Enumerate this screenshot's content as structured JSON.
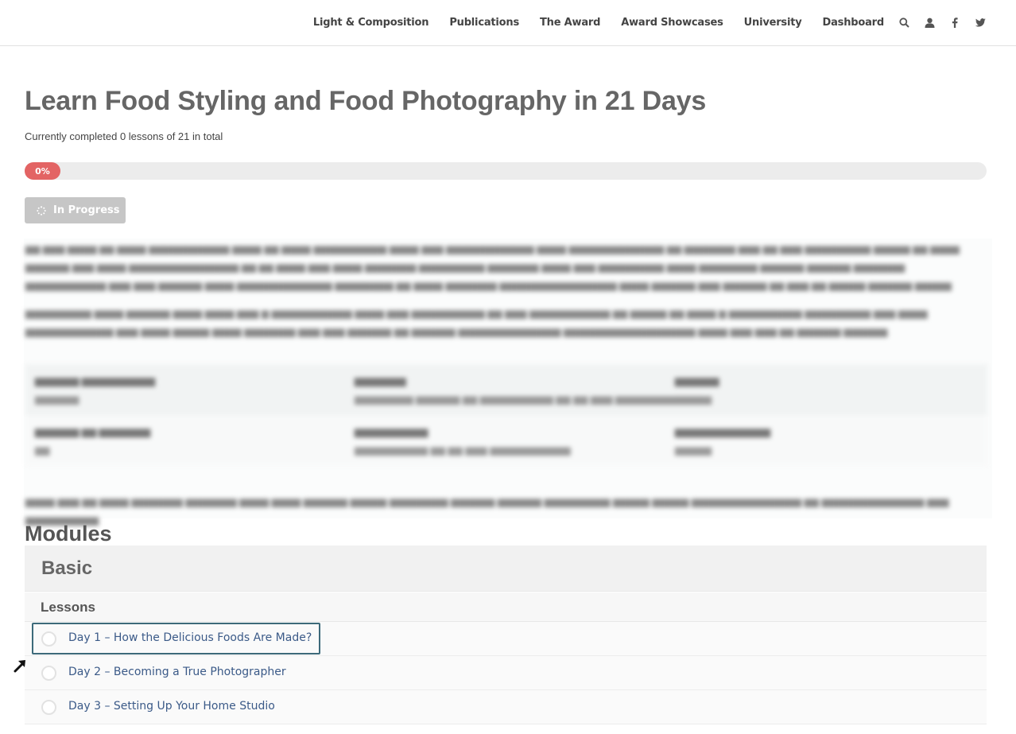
{
  "nav": {
    "links": [
      "Light & Composition",
      "Publications",
      "The Award",
      "Award Showcases",
      "University",
      "Dashboard"
    ],
    "icons": [
      "search-icon",
      "user-icon",
      "facebook-icon",
      "twitter-icon"
    ]
  },
  "course": {
    "title": "Learn Food Styling and Food Photography in 21 Days",
    "status_text": "Currently completed 0 lessons of 21 in total",
    "progress_percent": 0,
    "progress_label": "0%",
    "status_button_label": "In Progress"
  },
  "modules": {
    "heading": "Modules",
    "module_name": "Basic",
    "lessons_label": "Lessons",
    "lessons": [
      "Day 1 – How the Delicious Foods Are Made?",
      "Day 2 – Becoming a True Photographer",
      "Day 3 – Setting Up Your Home Studio"
    ]
  },
  "colors": {
    "progress": "#e36464",
    "status_button": "#c6c6c6",
    "lesson_link": "#3b5a88",
    "focus_outline": "#3d6a7a"
  }
}
